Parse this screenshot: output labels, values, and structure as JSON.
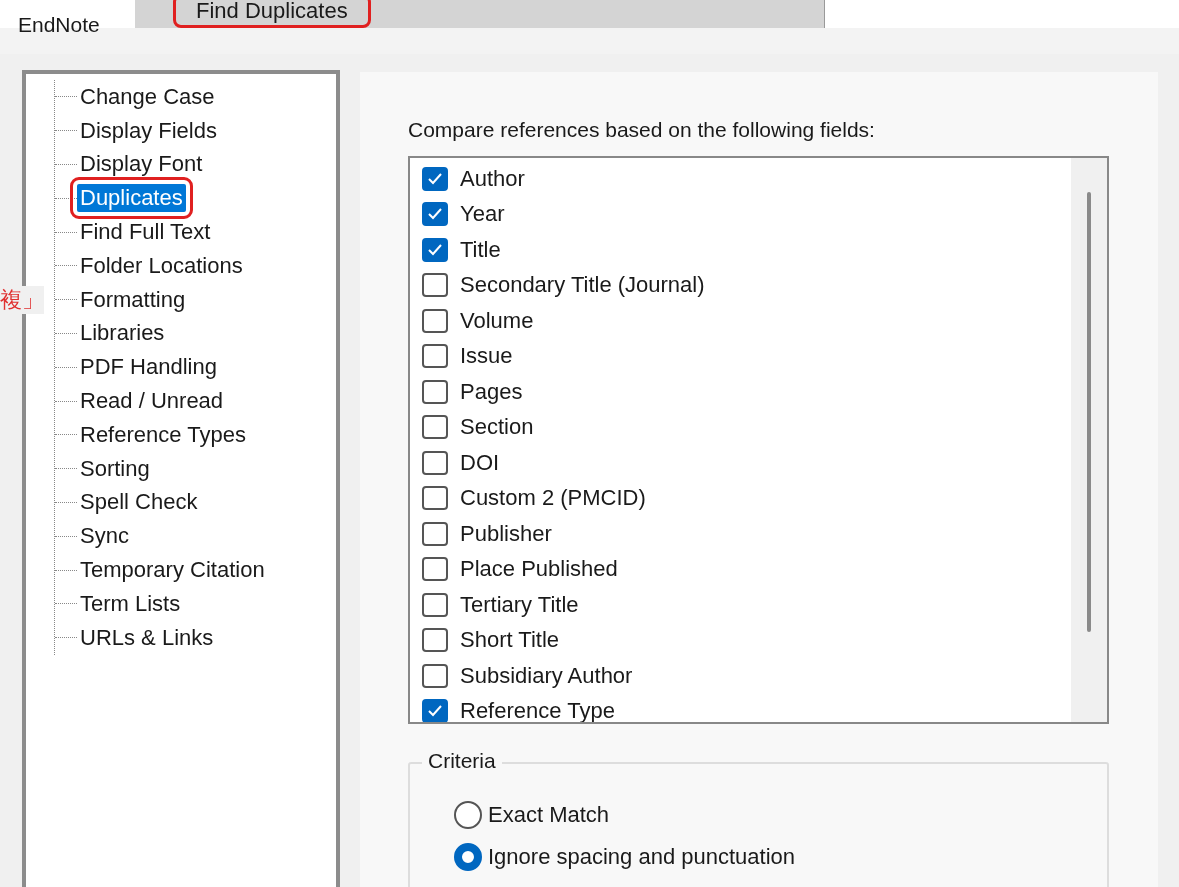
{
  "overlay_menu": {
    "label": "Find Duplicates"
  },
  "window": {
    "title": "EndNote"
  },
  "side_note": "複」",
  "tree": {
    "items": [
      {
        "label": "Change Case",
        "selected": false
      },
      {
        "label": "Display Fields",
        "selected": false
      },
      {
        "label": "Display Font",
        "selected": false
      },
      {
        "label": "Duplicates",
        "selected": true
      },
      {
        "label": "Find Full Text",
        "selected": false
      },
      {
        "label": "Folder Locations",
        "selected": false
      },
      {
        "label": "Formatting",
        "selected": false
      },
      {
        "label": "Libraries",
        "selected": false
      },
      {
        "label": "PDF Handling",
        "selected": false
      },
      {
        "label": "Read / Unread",
        "selected": false
      },
      {
        "label": "Reference Types",
        "selected": false
      },
      {
        "label": "Sorting",
        "selected": false
      },
      {
        "label": "Spell Check",
        "selected": false
      },
      {
        "label": "Sync",
        "selected": false
      },
      {
        "label": "Temporary Citation",
        "selected": false
      },
      {
        "label": "Term Lists",
        "selected": false
      },
      {
        "label": "URLs & Links",
        "selected": false
      }
    ]
  },
  "fields": {
    "label": "Compare references based on the following fields:",
    "items": [
      {
        "label": "Author",
        "checked": true
      },
      {
        "label": "Year",
        "checked": true
      },
      {
        "label": "Title",
        "checked": true
      },
      {
        "label": "Secondary Title (Journal)",
        "checked": false
      },
      {
        "label": "Volume",
        "checked": false
      },
      {
        "label": "Issue",
        "checked": false
      },
      {
        "label": "Pages",
        "checked": false
      },
      {
        "label": "Section",
        "checked": false
      },
      {
        "label": "DOI",
        "checked": false
      },
      {
        "label": "Custom 2 (PMCID)",
        "checked": false
      },
      {
        "label": "Publisher",
        "checked": false
      },
      {
        "label": "Place Published",
        "checked": false
      },
      {
        "label": "Tertiary Title",
        "checked": false
      },
      {
        "label": "Short Title",
        "checked": false
      },
      {
        "label": "Subsidiary Author",
        "checked": false
      },
      {
        "label": "Reference Type",
        "checked": true
      }
    ]
  },
  "criteria": {
    "title": "Criteria",
    "options": [
      {
        "label": "Exact Match",
        "selected": false
      },
      {
        "label": "Ignore spacing and punctuation",
        "selected": true
      }
    ]
  }
}
